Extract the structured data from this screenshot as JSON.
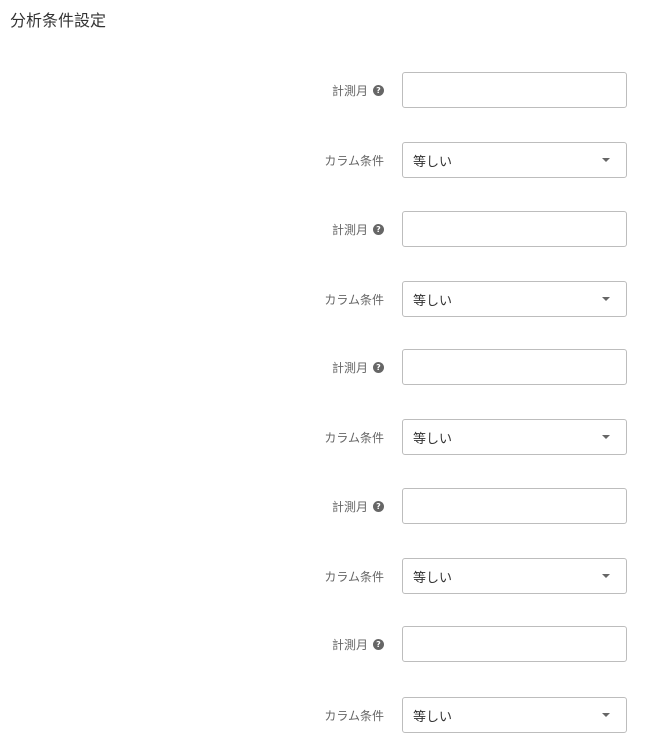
{
  "page": {
    "title": "分析条件設定"
  },
  "form": {
    "rows": [
      {
        "label": "計測月",
        "help_icon": "?",
        "value": ""
      },
      {
        "label": "カラム条件",
        "value": "等しい"
      },
      {
        "label": "計測月",
        "help_icon": "?",
        "value": ""
      },
      {
        "label": "カラム条件",
        "value": "等しい"
      },
      {
        "label": "計測月",
        "help_icon": "?",
        "value": ""
      },
      {
        "label": "カラム条件",
        "value": "等しい"
      },
      {
        "label": "計測月",
        "help_icon": "?",
        "value": ""
      },
      {
        "label": "カラム条件",
        "value": "等しい"
      },
      {
        "label": "計測月",
        "help_icon": "?",
        "value": ""
      },
      {
        "label": "カラム条件",
        "value": "等しい"
      }
    ]
  },
  "icons": {
    "help": "question-circle-icon",
    "dropdown": "chevron-down-icon"
  },
  "colors": {
    "text": "#333333",
    "label": "#666666",
    "border": "#bdbdbd"
  }
}
